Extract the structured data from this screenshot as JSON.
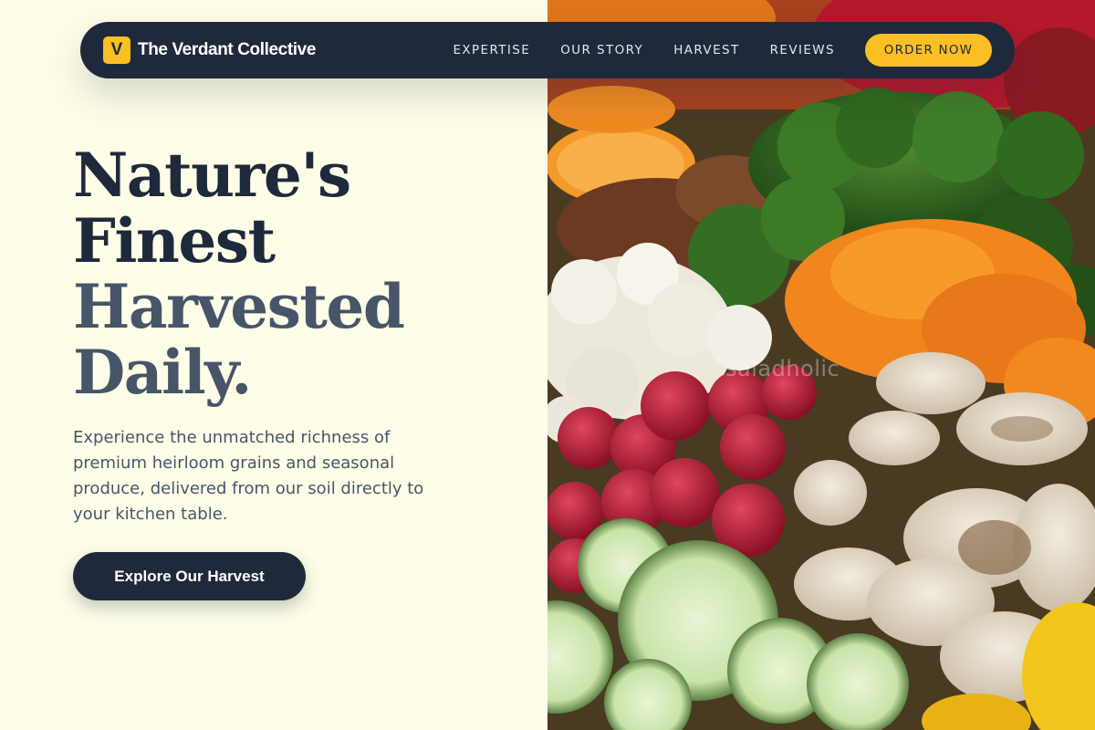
{
  "brand": {
    "logo_letter": "V",
    "name": "The Verdant Collective"
  },
  "nav": {
    "links": [
      "EXPERTISE",
      "OUR STORY",
      "HARVEST",
      "REVIEWS"
    ],
    "cta_label": "ORDER NOW"
  },
  "hero": {
    "headline_lines": [
      "Nature's",
      "Finest",
      "Harvested",
      "Daily."
    ],
    "description": "Experience the unmatched richness of premium heirloom grains and seasonal produce, delivered from our soil directly to your kitchen table.",
    "cta_label": "Explore Our Harvest",
    "image_watermark": "saladholic"
  },
  "colors": {
    "background": "#fefee8",
    "navy": "#1e293b",
    "slate": "#475569",
    "accent": "#fbbf24"
  }
}
